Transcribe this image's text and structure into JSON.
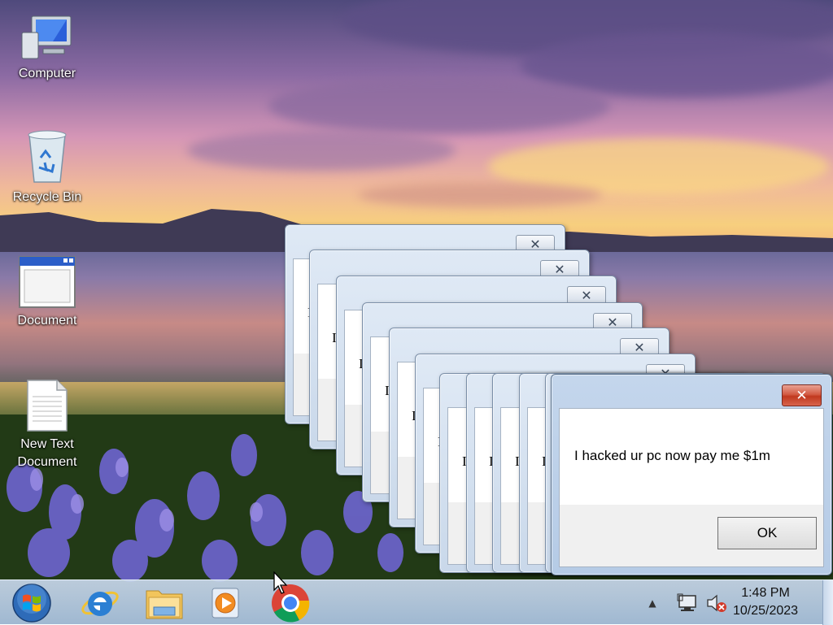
{
  "desktop": {
    "icons": [
      {
        "label": "Computer",
        "icon": "computer-icon"
      },
      {
        "label": "Recycle Bin",
        "icon": "recycle-bin-icon"
      },
      {
        "label": "Document",
        "icon": "document-window-icon"
      },
      {
        "label": "New Text Document",
        "icon": "text-document-icon"
      }
    ]
  },
  "dialog": {
    "message": "I hacked ur pc now pay me $1m",
    "ok_label": "OK",
    "partial_char": "I",
    "close_glyph": "✕"
  },
  "taskbar": {
    "start_icon": "windows-start-orb-icon",
    "pinned": [
      {
        "name": "internet-explorer-icon"
      },
      {
        "name": "file-explorer-icon"
      },
      {
        "name": "media-player-icon"
      },
      {
        "name": "chrome-icon"
      }
    ],
    "tray": {
      "overflow_glyph": "▲",
      "network_icon": "network-icon",
      "volume_icon": "volume-muted-icon"
    },
    "clock": {
      "time": "1:48 PM",
      "date": "10/25/2023"
    }
  },
  "colors": {
    "close_red": "#c0391f",
    "taskbar": "#b5cbe6"
  }
}
